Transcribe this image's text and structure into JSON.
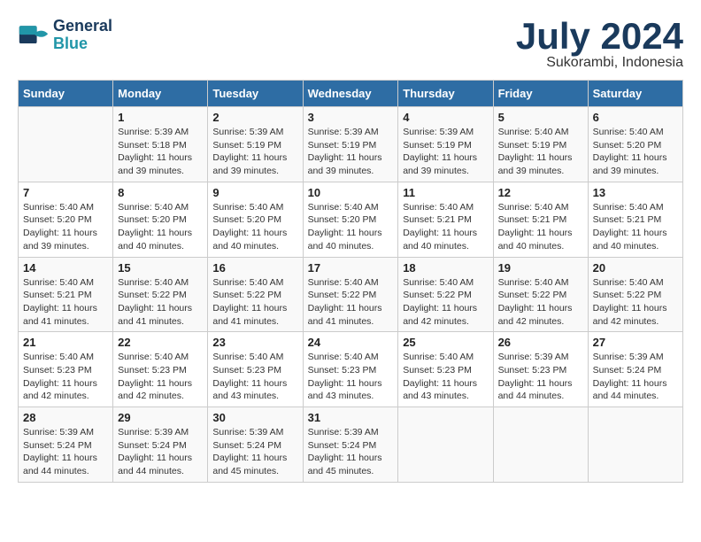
{
  "logo": {
    "line1": "General",
    "line2": "Blue"
  },
  "title": "July 2024",
  "subtitle": "Sukorambi, Indonesia",
  "days_of_week": [
    "Sunday",
    "Monday",
    "Tuesday",
    "Wednesday",
    "Thursday",
    "Friday",
    "Saturday"
  ],
  "weeks": [
    [
      {
        "num": "",
        "info": ""
      },
      {
        "num": "1",
        "info": "Sunrise: 5:39 AM\nSunset: 5:18 PM\nDaylight: 11 hours and 39 minutes."
      },
      {
        "num": "2",
        "info": "Sunrise: 5:39 AM\nSunset: 5:19 PM\nDaylight: 11 hours and 39 minutes."
      },
      {
        "num": "3",
        "info": "Sunrise: 5:39 AM\nSunset: 5:19 PM\nDaylight: 11 hours and 39 minutes."
      },
      {
        "num": "4",
        "info": "Sunrise: 5:39 AM\nSunset: 5:19 PM\nDaylight: 11 hours and 39 minutes."
      },
      {
        "num": "5",
        "info": "Sunrise: 5:40 AM\nSunset: 5:19 PM\nDaylight: 11 hours and 39 minutes."
      },
      {
        "num": "6",
        "info": "Sunrise: 5:40 AM\nSunset: 5:20 PM\nDaylight: 11 hours and 39 minutes."
      }
    ],
    [
      {
        "num": "7",
        "info": "Sunrise: 5:40 AM\nSunset: 5:20 PM\nDaylight: 11 hours and 39 minutes."
      },
      {
        "num": "8",
        "info": "Sunrise: 5:40 AM\nSunset: 5:20 PM\nDaylight: 11 hours and 40 minutes."
      },
      {
        "num": "9",
        "info": "Sunrise: 5:40 AM\nSunset: 5:20 PM\nDaylight: 11 hours and 40 minutes."
      },
      {
        "num": "10",
        "info": "Sunrise: 5:40 AM\nSunset: 5:20 PM\nDaylight: 11 hours and 40 minutes."
      },
      {
        "num": "11",
        "info": "Sunrise: 5:40 AM\nSunset: 5:21 PM\nDaylight: 11 hours and 40 minutes."
      },
      {
        "num": "12",
        "info": "Sunrise: 5:40 AM\nSunset: 5:21 PM\nDaylight: 11 hours and 40 minutes."
      },
      {
        "num": "13",
        "info": "Sunrise: 5:40 AM\nSunset: 5:21 PM\nDaylight: 11 hours and 40 minutes."
      }
    ],
    [
      {
        "num": "14",
        "info": "Sunrise: 5:40 AM\nSunset: 5:21 PM\nDaylight: 11 hours and 41 minutes."
      },
      {
        "num": "15",
        "info": "Sunrise: 5:40 AM\nSunset: 5:22 PM\nDaylight: 11 hours and 41 minutes."
      },
      {
        "num": "16",
        "info": "Sunrise: 5:40 AM\nSunset: 5:22 PM\nDaylight: 11 hours and 41 minutes."
      },
      {
        "num": "17",
        "info": "Sunrise: 5:40 AM\nSunset: 5:22 PM\nDaylight: 11 hours and 41 minutes."
      },
      {
        "num": "18",
        "info": "Sunrise: 5:40 AM\nSunset: 5:22 PM\nDaylight: 11 hours and 42 minutes."
      },
      {
        "num": "19",
        "info": "Sunrise: 5:40 AM\nSunset: 5:22 PM\nDaylight: 11 hours and 42 minutes."
      },
      {
        "num": "20",
        "info": "Sunrise: 5:40 AM\nSunset: 5:22 PM\nDaylight: 11 hours and 42 minutes."
      }
    ],
    [
      {
        "num": "21",
        "info": "Sunrise: 5:40 AM\nSunset: 5:23 PM\nDaylight: 11 hours and 42 minutes."
      },
      {
        "num": "22",
        "info": "Sunrise: 5:40 AM\nSunset: 5:23 PM\nDaylight: 11 hours and 42 minutes."
      },
      {
        "num": "23",
        "info": "Sunrise: 5:40 AM\nSunset: 5:23 PM\nDaylight: 11 hours and 43 minutes."
      },
      {
        "num": "24",
        "info": "Sunrise: 5:40 AM\nSunset: 5:23 PM\nDaylight: 11 hours and 43 minutes."
      },
      {
        "num": "25",
        "info": "Sunrise: 5:40 AM\nSunset: 5:23 PM\nDaylight: 11 hours and 43 minutes."
      },
      {
        "num": "26",
        "info": "Sunrise: 5:39 AM\nSunset: 5:23 PM\nDaylight: 11 hours and 44 minutes."
      },
      {
        "num": "27",
        "info": "Sunrise: 5:39 AM\nSunset: 5:24 PM\nDaylight: 11 hours and 44 minutes."
      }
    ],
    [
      {
        "num": "28",
        "info": "Sunrise: 5:39 AM\nSunset: 5:24 PM\nDaylight: 11 hours and 44 minutes."
      },
      {
        "num": "29",
        "info": "Sunrise: 5:39 AM\nSunset: 5:24 PM\nDaylight: 11 hours and 44 minutes."
      },
      {
        "num": "30",
        "info": "Sunrise: 5:39 AM\nSunset: 5:24 PM\nDaylight: 11 hours and 45 minutes."
      },
      {
        "num": "31",
        "info": "Sunrise: 5:39 AM\nSunset: 5:24 PM\nDaylight: 11 hours and 45 minutes."
      },
      {
        "num": "",
        "info": ""
      },
      {
        "num": "",
        "info": ""
      },
      {
        "num": "",
        "info": ""
      }
    ]
  ]
}
